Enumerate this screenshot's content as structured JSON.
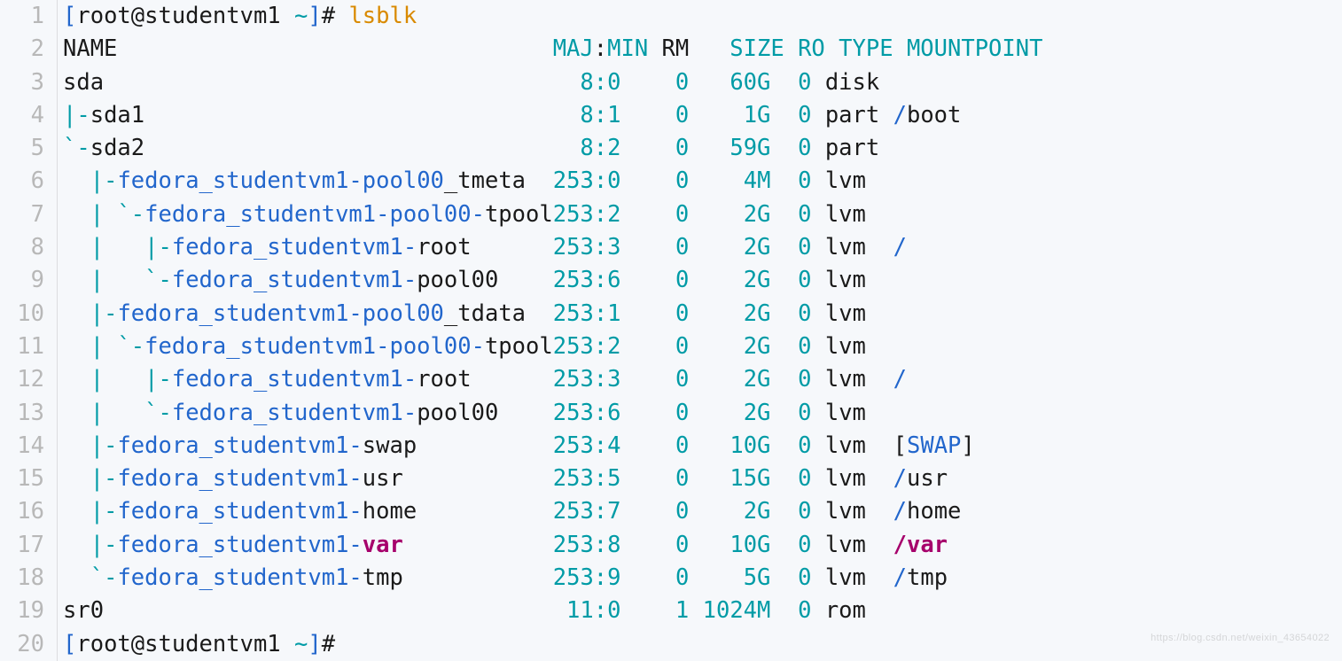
{
  "watermark": "https://blog.csdn.net/weixin_43654022",
  "gutter": [
    "1",
    "2",
    "3",
    "4",
    "5",
    "6",
    "7",
    "8",
    "9",
    "10",
    "11",
    "12",
    "13",
    "14",
    "15",
    "16",
    "17",
    "18",
    "19",
    "20"
  ],
  "prompt": {
    "lbr": "[",
    "user": "root",
    "at": "@",
    "host": "studentvm1",
    "sp": " ",
    "tilde": "~",
    "rbr": "]",
    "hash": "# ",
    "cmd": "lsblk"
  },
  "hdr": {
    "name": "NAME",
    "rest": "                                       MAJ:MIN RM   SIZE RO TYPE MOUNTPOINT"
  },
  "rows": [
    {
      "name_plain": "sda",
      "name_tree": "",
      "vg": "",
      "suffix": "",
      "maj": "8",
      "min": "0",
      "rm": "0",
      "size": "60G",
      "ro": "0",
      "type": "disk",
      "mnt": ""
    },
    {
      "name_tree": "|-",
      "name_plain": "sda1",
      "vg": "",
      "suffix": "",
      "maj": "8",
      "min": "1",
      "rm": "0",
      "size": "1G",
      "ro": "0",
      "type": "part",
      "mnt": "/boot",
      "mnt_style": "plain-slash"
    },
    {
      "name_tree": "`-",
      "name_plain": "sda2",
      "vg": "",
      "suffix": "",
      "maj": "8",
      "min": "2",
      "rm": "0",
      "size": "59G",
      "ro": "0",
      "type": "part",
      "mnt": ""
    },
    {
      "indent": "  ",
      "name_tree": "|-",
      "vg": "fedora_studentvm1-pool00",
      "suffix": "_tmeta",
      "maj": "253",
      "min": "0",
      "rm": "0",
      "size": "4M",
      "ro": "0",
      "type": "lvm",
      "mnt": ""
    },
    {
      "indent": "  ",
      "name_tree": "| `-",
      "vg": "fedora_studentvm1-pool00-",
      "suffix": "tpool",
      "maj": "253",
      "min": "2",
      "rm": "0",
      "size": "2G",
      "ro": "0",
      "type": "lvm",
      "mnt": ""
    },
    {
      "indent": "  ",
      "name_tree": "|   |-",
      "vg": "fedora_studentvm1-",
      "suffix": "root",
      "maj": "253",
      "min": "3",
      "rm": "0",
      "size": "2G",
      "ro": "0",
      "type": "lvm",
      "mnt": "/",
      "mnt_style": "slash"
    },
    {
      "indent": "  ",
      "name_tree": "|   `-",
      "vg": "fedora_studentvm1-",
      "suffix": "pool00",
      "maj": "253",
      "min": "6",
      "rm": "0",
      "size": "2G",
      "ro": "0",
      "type": "lvm",
      "mnt": ""
    },
    {
      "indent": "  ",
      "name_tree": "|-",
      "vg": "fedora_studentvm1-pool00",
      "suffix": "_tdata",
      "maj": "253",
      "min": "1",
      "rm": "0",
      "size": "2G",
      "ro": "0",
      "type": "lvm",
      "mnt": ""
    },
    {
      "indent": "  ",
      "name_tree": "| `-",
      "vg": "fedora_studentvm1-pool00-",
      "suffix": "tpool",
      "maj": "253",
      "min": "2",
      "rm": "0",
      "size": "2G",
      "ro": "0",
      "type": "lvm",
      "mnt": ""
    },
    {
      "indent": "  ",
      "name_tree": "|   |-",
      "vg": "fedora_studentvm1-",
      "suffix": "root",
      "maj": "253",
      "min": "3",
      "rm": "0",
      "size": "2G",
      "ro": "0",
      "type": "lvm",
      "mnt": "/",
      "mnt_style": "slash"
    },
    {
      "indent": "  ",
      "name_tree": "|   `-",
      "vg": "fedora_studentvm1-",
      "suffix": "pool00",
      "maj": "253",
      "min": "6",
      "rm": "0",
      "size": "2G",
      "ro": "0",
      "type": "lvm",
      "mnt": ""
    },
    {
      "indent": "  ",
      "name_tree": "|-",
      "vg": "fedora_studentvm1-",
      "suffix": "swap",
      "maj": "253",
      "min": "4",
      "rm": "0",
      "size": "10G",
      "ro": "0",
      "type": "lvm",
      "mnt": "[SWAP]",
      "mnt_style": "swap"
    },
    {
      "indent": "  ",
      "name_tree": "|-",
      "vg": "fedora_studentvm1-",
      "suffix": "usr",
      "maj": "253",
      "min": "5",
      "rm": "0",
      "size": "15G",
      "ro": "0",
      "type": "lvm",
      "mnt": "/usr",
      "mnt_style": "plain-slash"
    },
    {
      "indent": "  ",
      "name_tree": "|-",
      "vg": "fedora_studentvm1-",
      "suffix": "home",
      "maj": "253",
      "min": "7",
      "rm": "0",
      "size": "2G",
      "ro": "0",
      "type": "lvm",
      "mnt": "/home",
      "mnt_style": "plain-slash"
    },
    {
      "indent": "  ",
      "name_tree": "|-",
      "vg": "fedora_studentvm1-",
      "suffix": "var",
      "suffix_style": "var",
      "maj": "253",
      "min": "8",
      "rm": "0",
      "size": "10G",
      "ro": "0",
      "type": "lvm",
      "mnt": "/var",
      "mnt_style": "var"
    },
    {
      "indent": "  ",
      "name_tree": "`-",
      "vg": "fedora_studentvm1-",
      "suffix": "tmp",
      "maj": "253",
      "min": "9",
      "rm": "0",
      "size": "5G",
      "ro": "0",
      "type": "lvm",
      "mnt": "/tmp",
      "mnt_style": "plain-slash"
    },
    {
      "name_plain": "sr0",
      "name_tree": "",
      "vg": "",
      "suffix": "",
      "maj": "11",
      "min": "0",
      "rm": "1",
      "size": "1024M",
      "ro": "0",
      "type": "rom",
      "mnt": ""
    }
  ]
}
